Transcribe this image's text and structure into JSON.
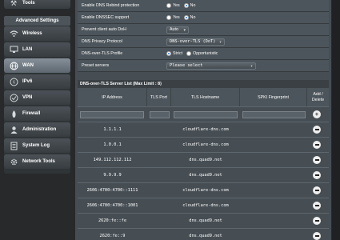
{
  "sidebar": {
    "tools_label": "Tools",
    "advanced_settings_label": "Advanced Settings",
    "items": [
      {
        "label": "Wireless",
        "icon": "wifi-icon"
      },
      {
        "label": "LAN",
        "icon": "lan-icon"
      },
      {
        "label": "WAN",
        "icon": "globe-icon",
        "active": true
      },
      {
        "label": "IPv6",
        "icon": "ipv6-icon"
      },
      {
        "label": "VPN",
        "icon": "vpn-icon"
      },
      {
        "label": "Firewall",
        "icon": "firewall-icon"
      },
      {
        "label": "Administration",
        "icon": "person-icon"
      },
      {
        "label": "System Log",
        "icon": "system-log-icon"
      },
      {
        "label": "Network Tools",
        "icon": "network-tools-icon"
      }
    ]
  },
  "settings": {
    "dns_rebind": {
      "label": "Enable DNS Rebind protection",
      "options": [
        "Yes",
        "No"
      ],
      "selected": "No"
    },
    "dnssec": {
      "label": "Enable DNSSEC support",
      "options": [
        "Yes",
        "No"
      ],
      "selected": "No"
    },
    "prevent_auto_dot": {
      "label": "Prevent client auto DoH",
      "value": "Auto"
    },
    "dns_privacy": {
      "label": "DNS Privacy Protocol",
      "value": "DNS-over-TLS (DoT)"
    },
    "dot_profile": {
      "label": "DNS-over-TLS Profile",
      "options": [
        "Strict",
        "Opportunistic"
      ],
      "selected": "Strict"
    },
    "preset_servers": {
      "label": "Preset servers",
      "value": "Please select"
    }
  },
  "server_list": {
    "title": "DNS-over-TLS Server List (Max Limit : 8)",
    "columns": [
      "IP Address",
      "TLS Port",
      "TLS Hostname",
      "SPKI Fingerprint",
      "Add / Delete"
    ],
    "rows": [
      {
        "ip": "1.1.1.1",
        "port": "",
        "hostname": "cloudflare-dns.com",
        "spki": ""
      },
      {
        "ip": "1.0.0.1",
        "port": "",
        "hostname": "cloudflare-dns.com",
        "spki": ""
      },
      {
        "ip": "149.112.112.112",
        "port": "",
        "hostname": "dns.quad9.net",
        "spki": ""
      },
      {
        "ip": "9.9.9.9",
        "port": "",
        "hostname": "dns.quad9.net",
        "spki": ""
      },
      {
        "ip": "2606:4700:4700::1111",
        "port": "",
        "hostname": "cloudflare-dns.com",
        "spki": ""
      },
      {
        "ip": "2606:4700:4700::1001",
        "port": "",
        "hostname": "cloudflare-dns.com",
        "spki": ""
      },
      {
        "ip": "2620:fe::fe",
        "port": "",
        "hostname": "dns.quad9.net",
        "spki": ""
      },
      {
        "ip": "2620:fe::9",
        "port": "",
        "hostname": "dns.quad9.net",
        "spki": ""
      }
    ]
  }
}
